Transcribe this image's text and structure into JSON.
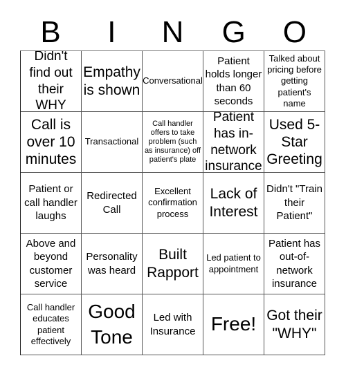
{
  "header": [
    "B",
    "I",
    "N",
    "G",
    "O"
  ],
  "cells": [
    {
      "text": "Didn't find out their WHY",
      "size": "lg"
    },
    {
      "text": "Empathy is shown",
      "size": "xl"
    },
    {
      "text": "Conversational",
      "size": "sm"
    },
    {
      "text": "Patient holds longer than 60 seconds",
      "size": "md"
    },
    {
      "text": "Talked about pricing before getting patient's name",
      "size": "sm"
    },
    {
      "text": "Call is over 10 minutes",
      "size": "xl"
    },
    {
      "text": "Transactional",
      "size": "sm"
    },
    {
      "text": "Call handler offers to take problem (such as insurance) off patient's plate",
      "size": "xs"
    },
    {
      "text": "Patient has in-network insurance",
      "size": "lg"
    },
    {
      "text": "Used 5-Star Greeting",
      "size": "xl"
    },
    {
      "text": "Patient or call handler laughs",
      "size": "md"
    },
    {
      "text": "Redirected Call",
      "size": "md"
    },
    {
      "text": "Excellent confirmation process",
      "size": "sm"
    },
    {
      "text": "Lack of Interest",
      "size": "xl"
    },
    {
      "text": "Didn't \"Train their Patient\"",
      "size": "md"
    },
    {
      "text": "Above and beyond customer service",
      "size": "md"
    },
    {
      "text": "Personality was heard",
      "size": "md"
    },
    {
      "text": "Built Rapport",
      "size": "xl"
    },
    {
      "text": "Led patient to appointment",
      "size": "sm"
    },
    {
      "text": "Patient has out-of-network insurance",
      "size": "md"
    },
    {
      "text": "Call handler educates patient effectively",
      "size": "sm"
    },
    {
      "text": "Good Tone",
      "size": "xxl"
    },
    {
      "text": "Led with Insurance",
      "size": "md"
    },
    {
      "text": "Free!",
      "size": "xxl"
    },
    {
      "text": "Got their \"WHY\"",
      "size": "xl"
    }
  ]
}
